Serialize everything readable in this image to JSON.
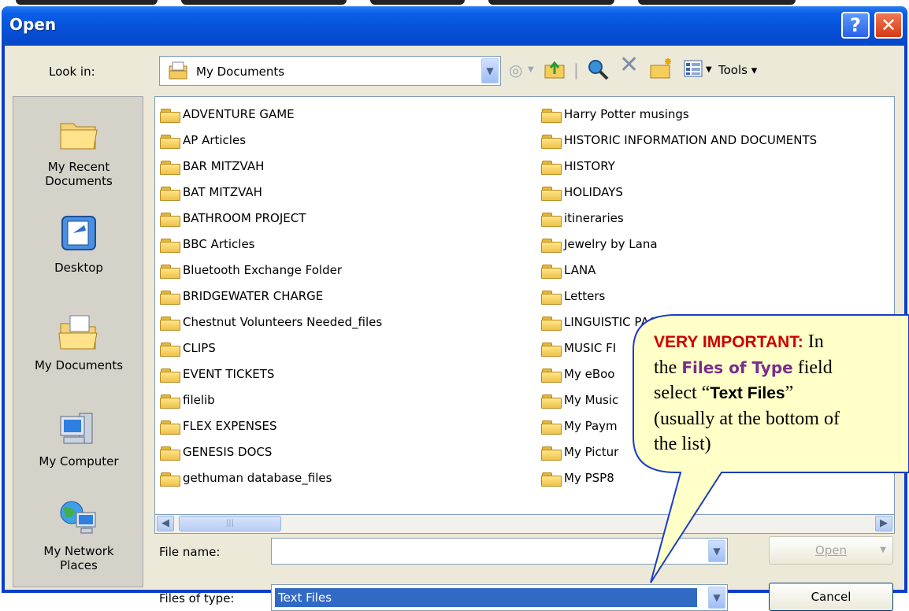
{
  "window": {
    "title": "Open",
    "help_label": "?",
    "close_label": "✕"
  },
  "toolbar": {
    "lookin_label": "Look in:",
    "lookin_value": "My Documents",
    "back_icon": "back-icon",
    "up_icon": "up-folder-icon",
    "search_icon": "search-web-icon",
    "delete_icon": "delete-icon",
    "newfolder_icon": "new-folder-icon",
    "views_icon": "views-icon",
    "tools_label": "Tools ▾"
  },
  "places": [
    {
      "label": "My Recent\nDocuments",
      "icon": "recent-documents-icon"
    },
    {
      "label": "Desktop",
      "icon": "desktop-icon"
    },
    {
      "label": "My Documents",
      "icon": "my-documents-icon"
    },
    {
      "label": "My Computer",
      "icon": "my-computer-icon"
    },
    {
      "label": "My Network\nPlaces",
      "icon": "network-places-icon"
    }
  ],
  "files": {
    "left": [
      "ADVENTURE GAME",
      "AP Articles",
      "BAR MITZVAH",
      "BAT MITZVAH",
      "BATHROOM PROJECT",
      "BBC Articles",
      "Bluetooth Exchange Folder",
      "BRIDGEWATER CHARGE",
      "Chestnut Volunteers Needed_files",
      "CLIPS",
      "EVENT TICKETS",
      "filelib",
      "FLEX EXPENSES",
      "GENESIS DOCS",
      "gethuman database_files"
    ],
    "right": [
      "Harry Potter musings",
      "HISTORIC INFORMATION AND DOCUMENTS",
      "HISTORY",
      "HOLIDAYS",
      "itineraries",
      "Jewelry  by  Lana",
      "LANA",
      "Letters",
      "LINGUISTIC PAGES",
      "MUSIC FI",
      "My eBoo",
      "My Music",
      "My Paym",
      "My Pictur",
      "My PSP8"
    ]
  },
  "form": {
    "filename_label": "File name:",
    "filename_value": "",
    "filetype_label": "Files of type:",
    "filetype_value": "Text Files",
    "open_label": "Open",
    "cancel_label": "Cancel"
  },
  "callout": {
    "line1_red": "VERY IMPORTANT:",
    "line1_rest": " In",
    "line2_pre": "the ",
    "line2_purple": "Files of Type",
    "line2_post": " field",
    "line3_pre": "select “",
    "line3_bold": "Text Files",
    "line3_post": "”",
    "line4": "(usually at the bottom of",
    "line5": "the list)"
  },
  "colors": {
    "titlebar": "#0650d8",
    "selection": "#316ac5",
    "callout_fill": "#ffffc8",
    "callout_border": "#1a3cc8"
  }
}
